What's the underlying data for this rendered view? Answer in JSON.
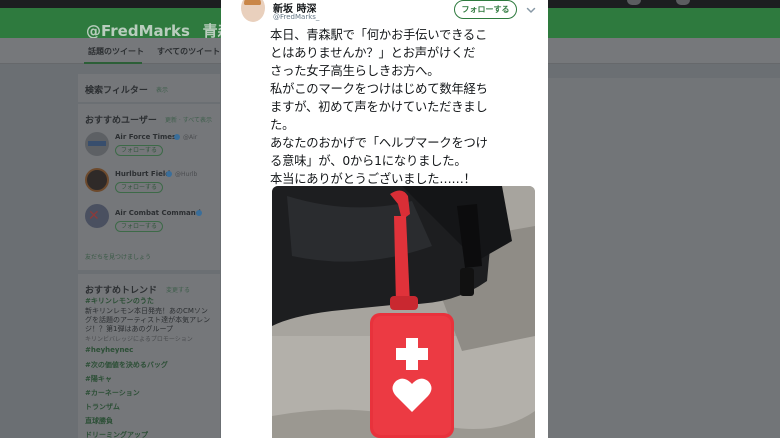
{
  "background_page": {
    "banner_title": "@FredMarks_ 青森駅",
    "tabs": [
      "話題のツイート",
      "すべてのツイート"
    ],
    "search_filter": {
      "title": "検索フィルター",
      "action": "表示"
    },
    "recommended_users": {
      "title": "おすすめユーザー",
      "actions": "更新 · すべて表示",
      "users": [
        {
          "name": "Air Force Times",
          "handle": "@Air",
          "follow_label": "フォローする"
        },
        {
          "name": "Hurlburt Field",
          "handle": "@Hurlb",
          "follow_label": "フォローする"
        },
        {
          "name": "Air Combat Command",
          "handle": "",
          "follow_label": "フォローする"
        }
      ],
      "find_friends": "友だちを見つけましょう"
    },
    "trends": {
      "title": "おすすめトレンド",
      "action": "変更する",
      "items": [
        {
          "name": "#キリンレモンのうた",
          "description": [
            "新キリンレモン本日発売！あのCMソン",
            "グを話題のアーティスト達が本気アレン",
            "ジ！？第1弾はあのグループ"
          ],
          "promoted": "キリンビバレッジによるプロモーション"
        },
        {
          "name": "#heyheynec"
        },
        {
          "name": "#次の価値を決めるバッグ"
        },
        {
          "name": "#陽キャ"
        },
        {
          "name": "#カーネーション"
        },
        {
          "name": "トランザム"
        },
        {
          "name": "直球勝負"
        },
        {
          "name": "ドリーミングアップ"
        }
      ]
    }
  },
  "tweet": {
    "author_name": "新坂 時深",
    "author_handle": "@FredMarks_",
    "follow_label": "フォローする",
    "menu_icon": "chevron-down-icon",
    "text_lines": [
      "本日、青森駅で「何かお手伝いできるこ",
      "とはありませんか？」とお声がけくだ",
      "さった女子高生らしきお方へ。",
      "私がこのマークをつけはじめて数年経ち",
      "ますが、初めて声をかけていただきまし",
      "た。",
      "あなたのおかげで「ヘルプマークをつけ",
      "る意味」が、0から1になりました。",
      "本当にありがとうございました……！"
    ],
    "photo_description": "help-mark-tag"
  },
  "colors": {
    "accent": "#2e7a3e",
    "help_mark_red": "#e8323c",
    "overlay": "#6b6f73"
  }
}
